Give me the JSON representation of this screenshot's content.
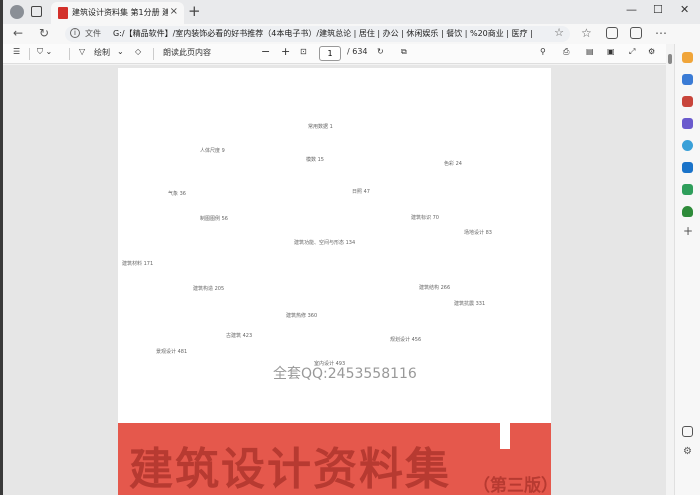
{
  "browser": {
    "tab_title": "建筑设计资料集 第1分册 建筑总...",
    "new_tab": "+",
    "close_tab": "×",
    "url_scheme": "文件",
    "url_path": "G:/【精品软件】/室内装饰必看的好书推荐（4本电子书）/建筑总论 | 居住 | 办公 | 休闲娱乐 | 餐饮 | %20商业 | 医疗 | 建筑资...",
    "win_min": "—",
    "win_max": "☐",
    "win_close": "✕"
  },
  "pdf_toolbar": {
    "draw_label": "绘制",
    "read_aloud_label": "朗读此页内容",
    "zoom_out": "−",
    "zoom_in": "+",
    "page_current": "1",
    "page_total": "/ 634"
  },
  "page": {
    "labels": [
      "常用数据  1",
      "人体尺度  9",
      "模数  15",
      "色彩  24",
      "气象  36",
      "日照  47",
      "制图图例  56",
      "建筑标识  70",
      "场地设计  83",
      "建筑功能、空间与形态  134",
      "建筑材料  171",
      "建筑构造  205",
      "建筑结构  266",
      "建筑抗震  331",
      "建筑热修  360",
      "古建筑  423",
      "规划设计  456",
      "景观设计  481",
      "室内设计  493"
    ],
    "watermark": "全套QQ:2453558116",
    "book_title": "建筑设计资料集",
    "edition": "（第三版）"
  }
}
